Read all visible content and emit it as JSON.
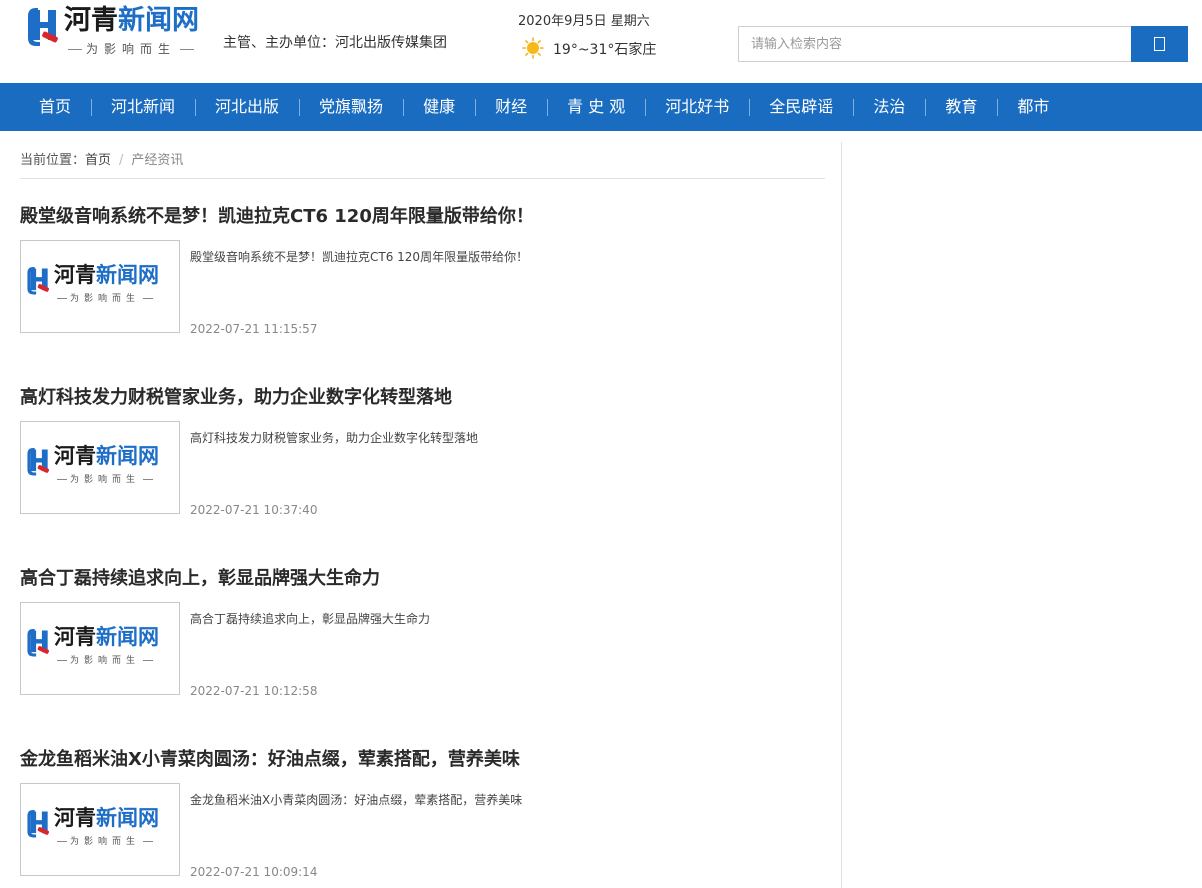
{
  "header": {
    "logo": {
      "name_part1": "河青",
      "name_part2": "新闻网",
      "slogan": "为影响而生"
    },
    "sponsor": "主管、主办单位：河北出版传媒集团",
    "date": "2020年9月5日 星期六",
    "weather": {
      "icon": "sun-icon",
      "text": "19°~31°石家庄"
    },
    "search": {
      "placeholder": "请输入检索内容",
      "value": "",
      "button_icon": "search-icon"
    }
  },
  "nav": {
    "items": [
      {
        "label": "首页"
      },
      {
        "label": "河北新闻"
      },
      {
        "label": "河北出版"
      },
      {
        "label": "党旗飘扬"
      },
      {
        "label": "健康"
      },
      {
        "label": "财经"
      },
      {
        "label": "青 史 观"
      },
      {
        "label": "河北好书"
      },
      {
        "label": "全民辟谣"
      },
      {
        "label": "法治"
      },
      {
        "label": "教育"
      },
      {
        "label": "都市"
      }
    ]
  },
  "breadcrumb": {
    "prefix": "当前位置：",
    "home": "首页",
    "separator": "/",
    "current": "产经资讯"
  },
  "articles": [
    {
      "title": "殿堂级音响系统不是梦！凯迪拉克CT6 120周年限量版带给你！",
      "summary": "殿堂级音响系统不是梦！凯迪拉克CT6 120周年限量版带给你！",
      "time": "2022-07-21 11:15:57"
    },
    {
      "title": "高灯科技发力财税管家业务，助力企业数字化转型落地",
      "summary": "高灯科技发力财税管家业务，助力企业数字化转型落地",
      "time": "2022-07-21 10:37:40"
    },
    {
      "title": "高合丁磊持续追求向上，彰显品牌强大生命力",
      "summary": "高合丁磊持续追求向上，彰显品牌强大生命力",
      "time": "2022-07-21 10:12:58"
    },
    {
      "title": "金龙鱼稻米油X小青菜肉圆汤：好油点缀，荤素搭配，营养美味",
      "summary": "金龙鱼稻米油X小青菜肉圆汤：好油点缀，荤素搭配，营养美味",
      "time": "2022-07-21 10:09:14"
    }
  ],
  "colors": {
    "brand_blue": "#1a6cc0",
    "logo_blue": "#1e6ec8",
    "logo_red": "#d9262c"
  }
}
